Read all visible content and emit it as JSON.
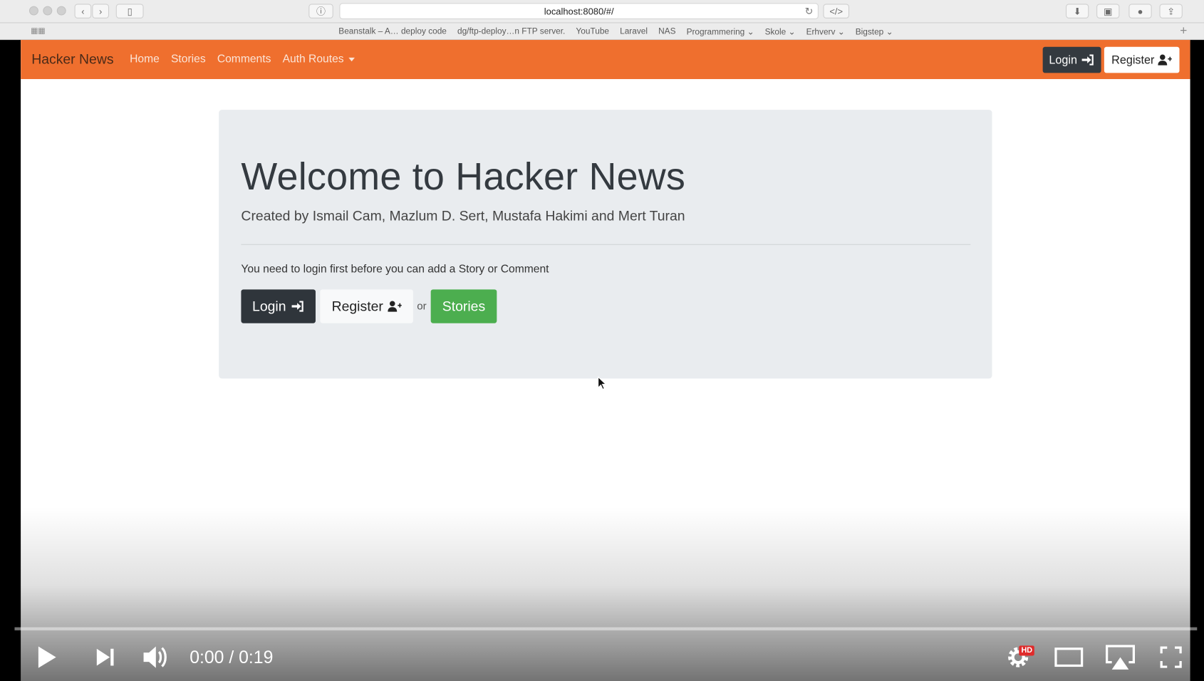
{
  "browser": {
    "url": "localhost:8080/#/",
    "bookmarks": [
      "Beanstalk – A… deploy code",
      "dg/ftp-deploy…n FTP server.",
      "YouTube",
      "Laravel",
      "NAS",
      "Programmering ⌄",
      "Skole ⌄",
      "Erhverv ⌄",
      "Bigstep ⌄"
    ]
  },
  "navbar": {
    "brand": "Hacker News",
    "links": [
      "Home",
      "Stories",
      "Comments",
      "Auth Routes"
    ],
    "login_label": "Login",
    "register_label": "Register",
    "color": "#ef6f2e"
  },
  "jumbotron": {
    "title": "Welcome to Hacker News",
    "lead": "Created by Ismail Cam, Mazlum D. Sert, Mustafa Hakimi and Mert Turan",
    "message": "You need to login first before you can add a Story or Comment",
    "login_label": "Login",
    "register_label": "Register",
    "or_text": "or",
    "stories_label": "Stories"
  },
  "video": {
    "time": "0:00 / 0:19",
    "hd_badge": "HD",
    "progress": 0
  }
}
